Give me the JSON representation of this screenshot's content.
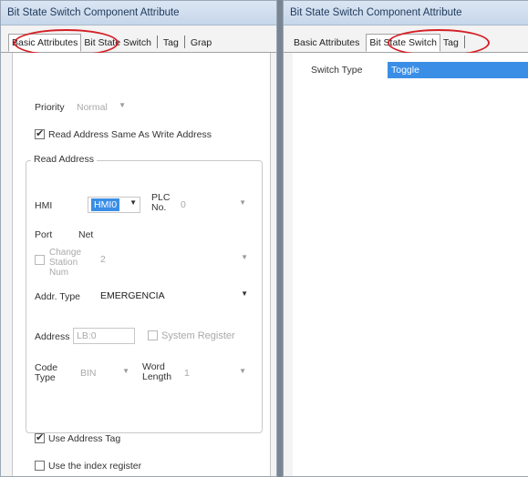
{
  "left_window": {
    "title": "Bit State Switch Component Attribute",
    "tabs": [
      {
        "label": "Basic Attributes"
      },
      {
        "label": "Bit State Switch"
      },
      {
        "label": "Tag"
      },
      {
        "label": "Grap"
      }
    ],
    "priority": {
      "label": "Priority",
      "value": "Normal"
    },
    "read_same_checkbox": {
      "label": "Read Address Same As Write Address",
      "checked": true
    },
    "read_address_group": {
      "title": "Read Address",
      "hmi": {
        "label": "HMI",
        "value": "HMI0"
      },
      "plc_no": {
        "label": "PLC No.",
        "value": "0"
      },
      "port": {
        "label": "Port",
        "value": "Net"
      },
      "change_station": {
        "label": "Change Station Num",
        "value": "2",
        "checked": false
      },
      "addr_type": {
        "label": "Addr. Type",
        "value": "EMERGENCIA"
      },
      "address": {
        "label": "Address",
        "value": "LB:0"
      },
      "system_register": {
        "label": "System Register",
        "checked": false
      },
      "code_type": {
        "label": "Code Type",
        "value": "BIN"
      },
      "word_length": {
        "label": "Word Length",
        "value": "1"
      }
    },
    "use_address_tag": {
      "label": "Use Address Tag",
      "checked": true
    },
    "use_index_register": {
      "label": "Use the index register",
      "checked": false
    }
  },
  "right_window": {
    "title": "Bit State Switch Component Attribute",
    "tabs": [
      {
        "label": "Basic Attributes"
      },
      {
        "label": "Bit State Switch"
      },
      {
        "label": "Tag"
      }
    ],
    "switch_type": {
      "label": "Switch Type",
      "value": "Toggle"
    }
  },
  "colors": {
    "highlight_circle": "#d42027",
    "selection": "#3a8ee6",
    "titlebar": "#c6d6ea"
  }
}
